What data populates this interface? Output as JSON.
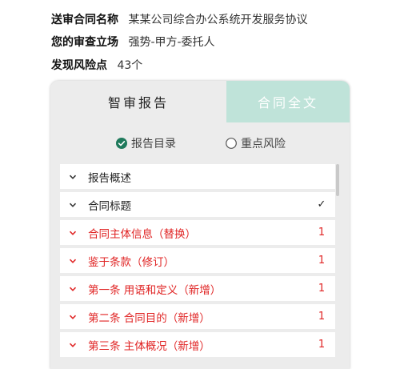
{
  "header": {
    "contract_name_label": "送审合同名称",
    "contract_name_value": "某某公司综合办公系统开发服务协议",
    "stance_label": "您的审查立场",
    "stance_value": "强势-甲方-委托人",
    "risk_label": "发现风险点",
    "risk_value": "43个"
  },
  "tabs": {
    "active": "智审报告",
    "inactive": "合同全文"
  },
  "radios": [
    {
      "label": "报告目录",
      "selected": true
    },
    {
      "label": "重点风险",
      "selected": false
    }
  ],
  "items": [
    {
      "label": "报告概述",
      "count": "",
      "status": "normal",
      "checked": false
    },
    {
      "label": "合同标题",
      "count": "✓",
      "status": "normal",
      "checked": true
    },
    {
      "label": "合同主体信息（替换）",
      "count": "1",
      "status": "risk"
    },
    {
      "label": "鉴于条款（修订）",
      "count": "1",
      "status": "risk"
    },
    {
      "label": "第一条 用语和定义（新增）",
      "count": "1",
      "status": "risk"
    },
    {
      "label": "第二条 合同目的（新增）",
      "count": "1",
      "status": "risk"
    },
    {
      "label": "第三条 主体概况（新增）",
      "count": "1",
      "status": "risk"
    }
  ],
  "colors": {
    "accent": "#1f7a5c",
    "risk": "#e02424",
    "tab_inactive_bg": "#bfe3d9"
  }
}
